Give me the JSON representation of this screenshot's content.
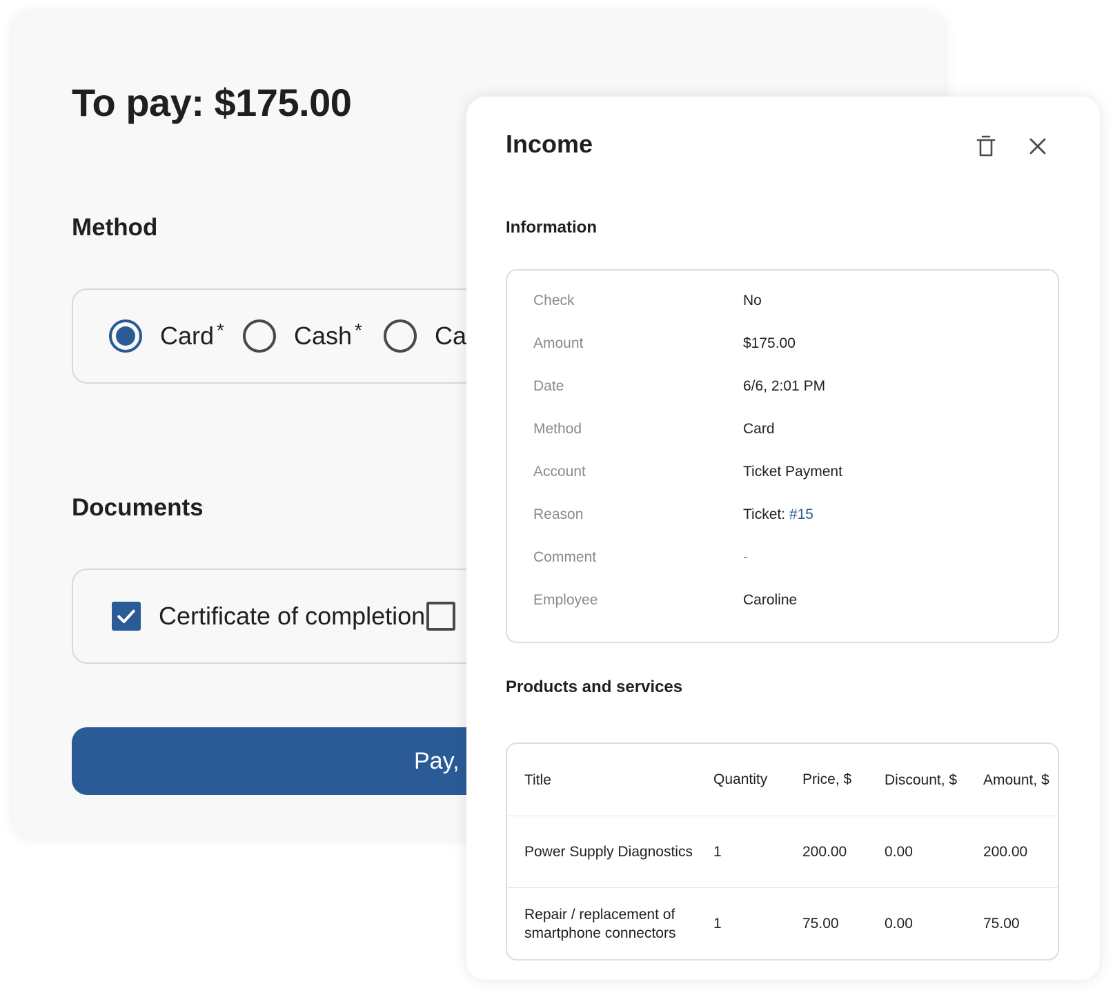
{
  "payment": {
    "title": "To pay: $175.00",
    "method_heading": "Method",
    "methods": [
      {
        "label": "Card",
        "mark": "*",
        "selected": true
      },
      {
        "label": "Cash",
        "mark": "*",
        "selected": false
      },
      {
        "label": "Ca",
        "selected": false
      }
    ],
    "documents_heading": "Documents",
    "documents": [
      {
        "label": "Certificate of completion",
        "checked": true
      },
      {
        "label": "",
        "checked": false
      }
    ],
    "pay_button_label": "Pay, $"
  },
  "income": {
    "title": "Income",
    "icons": {
      "delete": "trash-icon",
      "close": "close-icon"
    },
    "information_heading": "Information",
    "information": {
      "check": {
        "label": "Check",
        "value": "No"
      },
      "amount": {
        "label": "Amount",
        "value": "$175.00"
      },
      "date": {
        "label": "Date",
        "value": "6/6, 2:01 PM"
      },
      "method": {
        "label": "Method",
        "value": "Card"
      },
      "account": {
        "label": "Account",
        "value": "Ticket Payment"
      },
      "reason": {
        "label": "Reason",
        "prefix": "Ticket: ",
        "link": "#15"
      },
      "comment": {
        "label": "Comment",
        "value": "-"
      },
      "employee": {
        "label": "Employee",
        "value": "Caroline"
      }
    },
    "products_heading": "Products and services",
    "table": {
      "headers": {
        "title": "Title",
        "quantity": "Quantity",
        "price": "Price, $",
        "discount": "Discount, $",
        "amount": "Amount, $"
      },
      "rows": [
        {
          "title": "Power Supply Diagnostics",
          "quantity": "1",
          "price": "200.00",
          "discount": "0.00",
          "amount": "200.00"
        },
        {
          "title": "Repair / replacement of smartphone connectors",
          "quantity": "1",
          "price": "75.00",
          "discount": "0.00",
          "amount": "75.00"
        }
      ]
    }
  },
  "colors": {
    "accent": "#2a5b97",
    "label_gray": "#8a8a8a",
    "border": "#dedede"
  }
}
